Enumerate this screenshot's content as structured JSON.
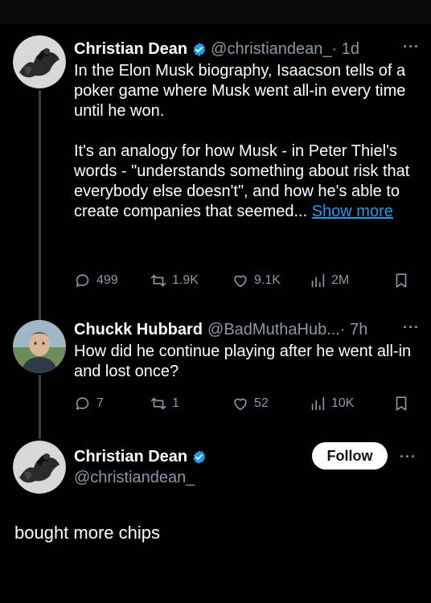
{
  "tweet1": {
    "name": "Christian Dean",
    "handle": "@christiandean_",
    "time": " · 1d",
    "more": "···",
    "paragraph1": "In the Elon Musk biography, Isaacson tells of a poker game where Musk went all-in every time until he won.",
    "paragraph2": "It's an analogy for how Musk - in Peter Thiel's words - \"understands something about risk that everybody else doesn't\", and how he's able to create companies that seemed...",
    "show_more": "Show more",
    "replies": "499",
    "reposts": "1.9K",
    "likes": "9.1K",
    "views": "2M",
    "bookmark_icon": "bookmark-icon"
  },
  "tweet2": {
    "name": "Chuckk Hubbard",
    "handle": "@BadMuthaHub...",
    "time": " · 7h",
    "more": "···",
    "text": "How did he continue playing after he went all-in and lost once?",
    "replies": "7",
    "reposts": "1",
    "likes": "52",
    "views": "10K"
  },
  "tweet3": {
    "name": "Christian Dean",
    "handle": "@christiandean_",
    "more": "···",
    "follow_label": "Follow",
    "text": "bought more chips"
  },
  "colors": {
    "background": "#000000",
    "text": "#ffffff",
    "muted": "#8b98a5",
    "link": "#1d9bf0",
    "verified": "#1d9bf0"
  }
}
